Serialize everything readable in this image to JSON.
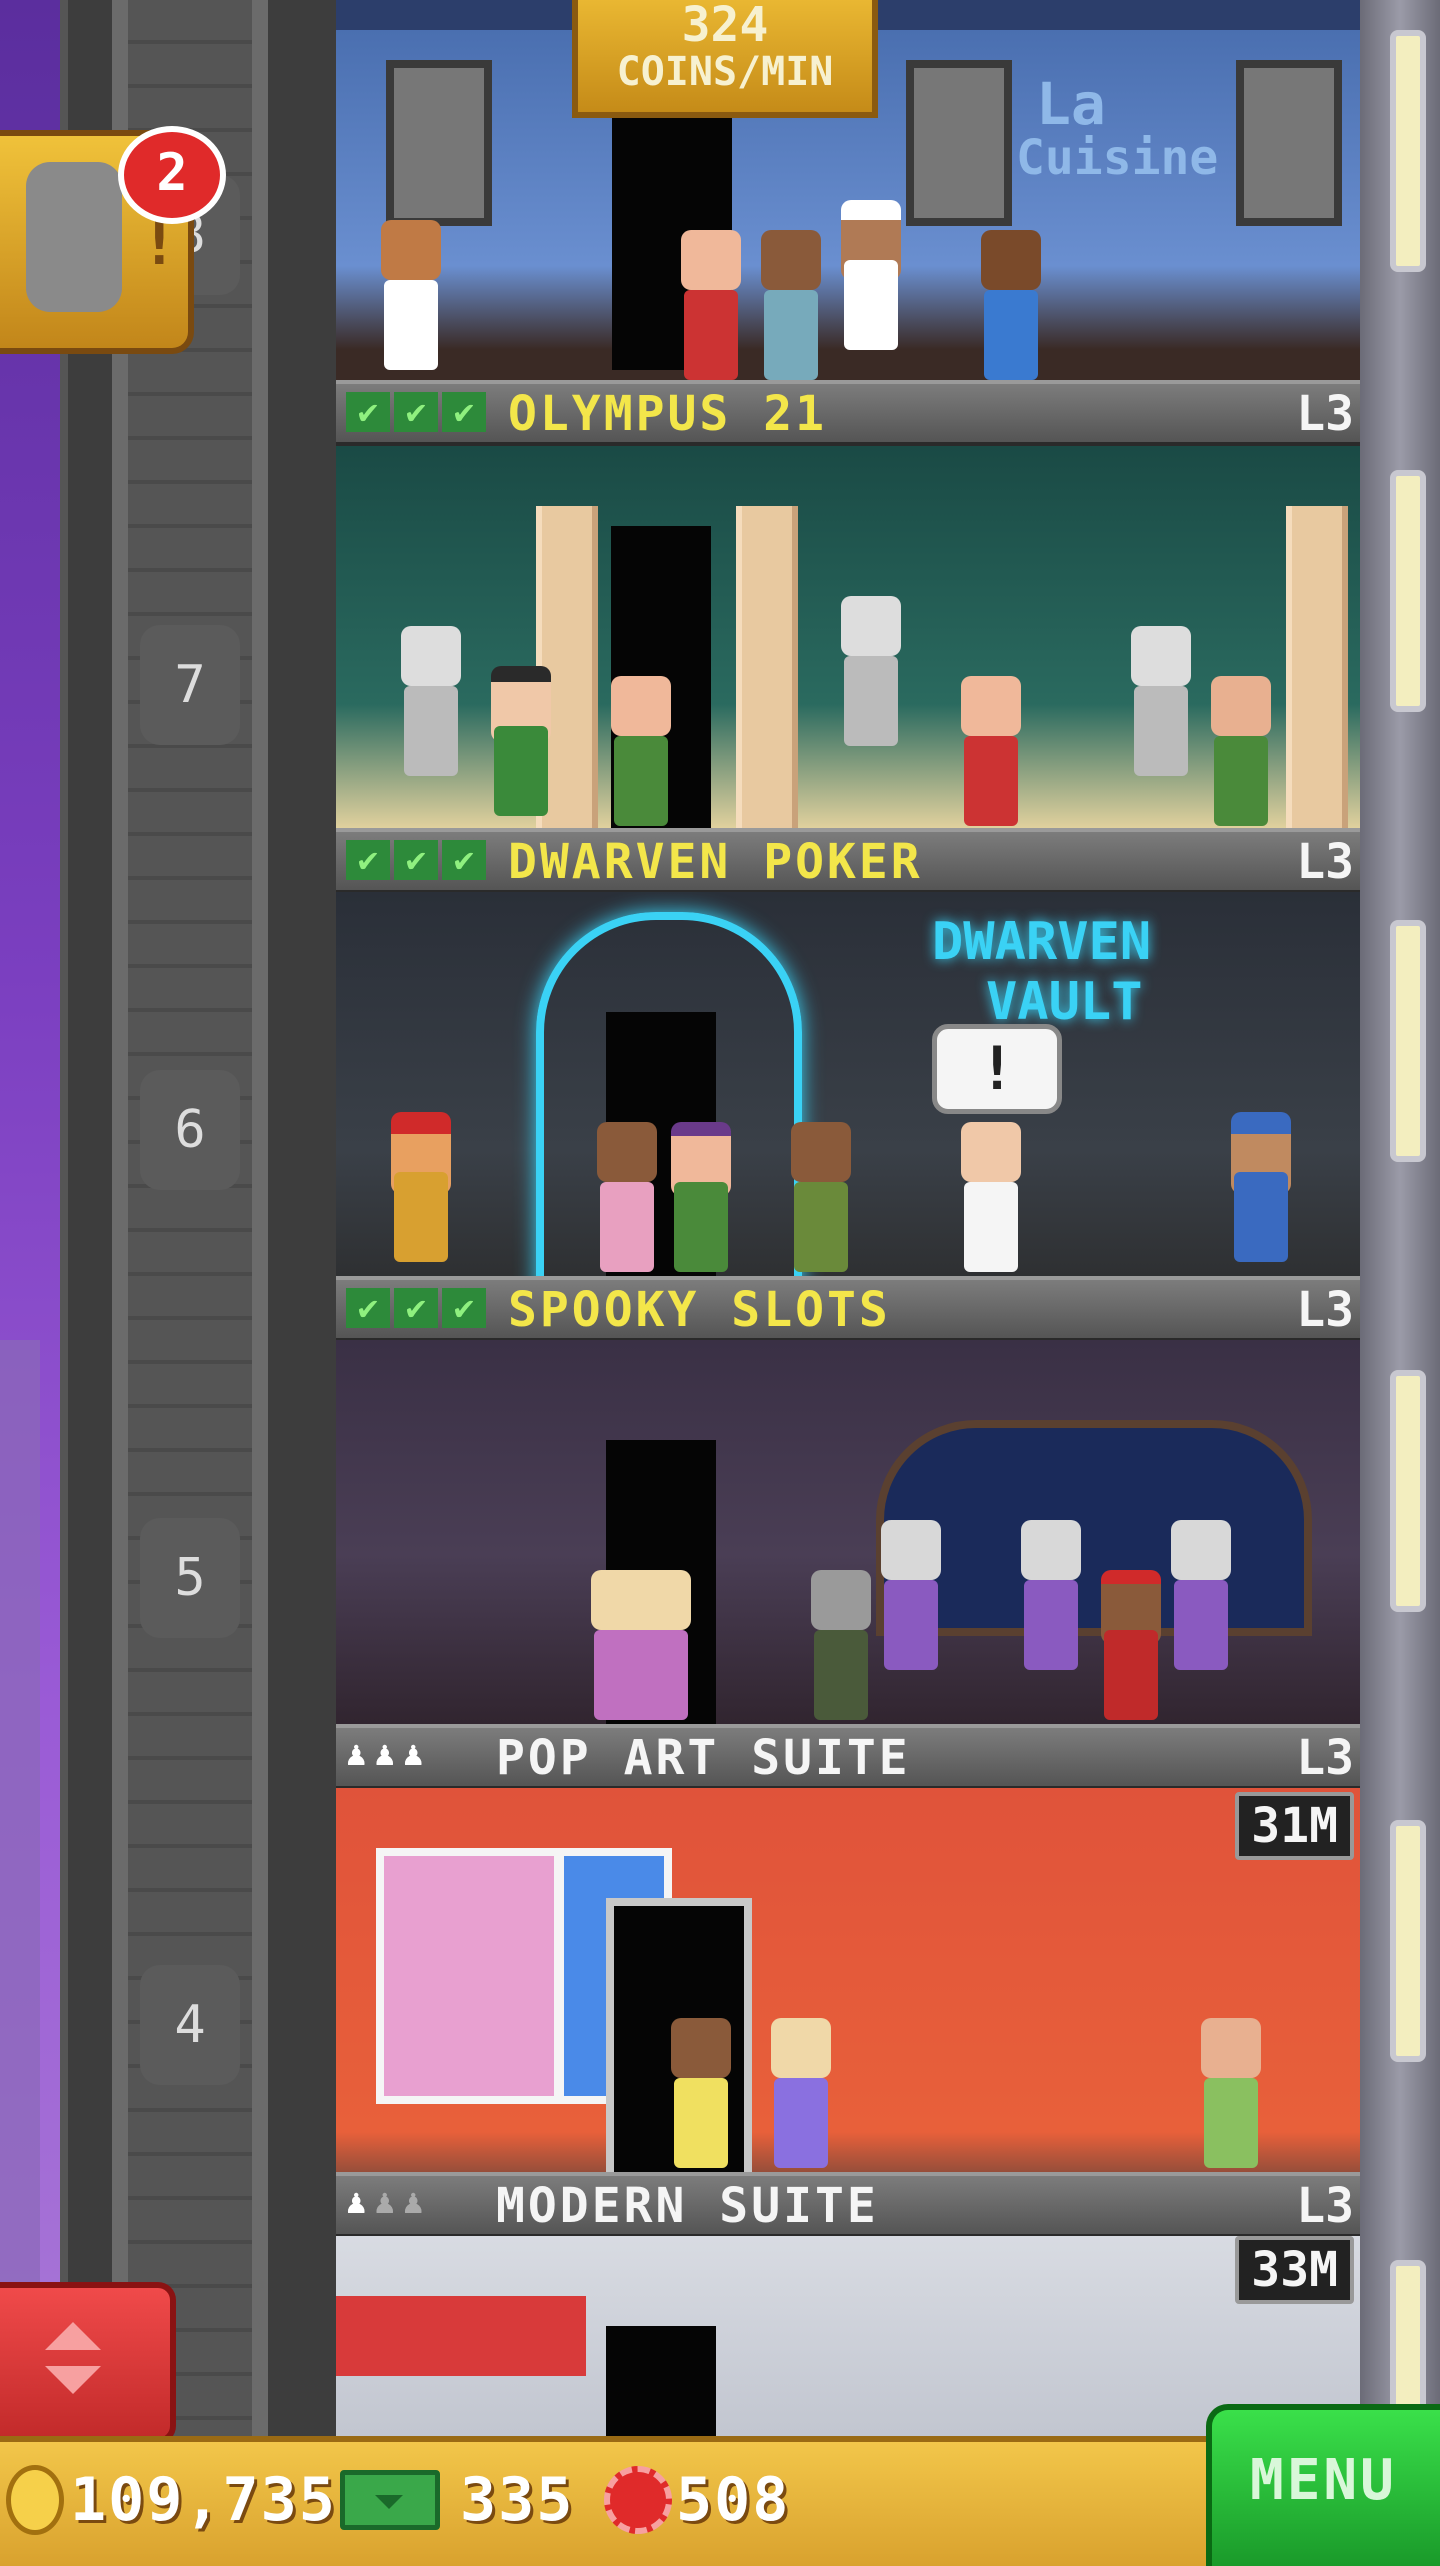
{
  "top_room": {
    "coins_per_min_value": "324",
    "coins_per_min_label": "COINS/MIN",
    "sign_line1": "La",
    "sign_line2": "Cuisine",
    "floor_number": "8"
  },
  "notification": {
    "badge_count": "2",
    "exclamation": "!"
  },
  "floors": [
    {
      "name": "OLYMPUS 21",
      "level": "L3",
      "number": "7",
      "checks": [
        "✔",
        "✔",
        "✔"
      ]
    },
    {
      "name": "DWARVEN POKER",
      "level": "L3",
      "number": "6",
      "checks": [
        "✔",
        "✔",
        "✔"
      ],
      "sign_line1": "DWARVEN",
      "sign_line2": "VAULT",
      "speech": "!"
    },
    {
      "name": "SPOOKY SLOTS",
      "level": "L3",
      "number": "5",
      "checks": [
        "✔",
        "✔",
        "✔"
      ]
    },
    {
      "name": "POP ART SUITE",
      "level": "L3",
      "number": "4",
      "price": "31M",
      "pawns": [
        "♟",
        "♟",
        "♟"
      ]
    },
    {
      "name": "MODERN SUITE",
      "level": "L3",
      "price": "33M",
      "pawns": [
        "♟",
        "♟",
        "♟"
      ]
    }
  ],
  "bottom_bar": {
    "coins": "109,735",
    "bux": "335",
    "chips": "508",
    "menu_label": "MENU"
  },
  "icons": {
    "coin": "coin-icon",
    "bux": "bux-icon",
    "chip": "chip-icon",
    "elevator": "elevator-updown-icon"
  },
  "colors": {
    "floor_name_yellow": "#f3e64a",
    "check_green": "#2d8a3a",
    "menu_green": "#2ac23a",
    "bottom_bar_gold": "#e8b63a",
    "badge_red": "#e02a2a"
  }
}
